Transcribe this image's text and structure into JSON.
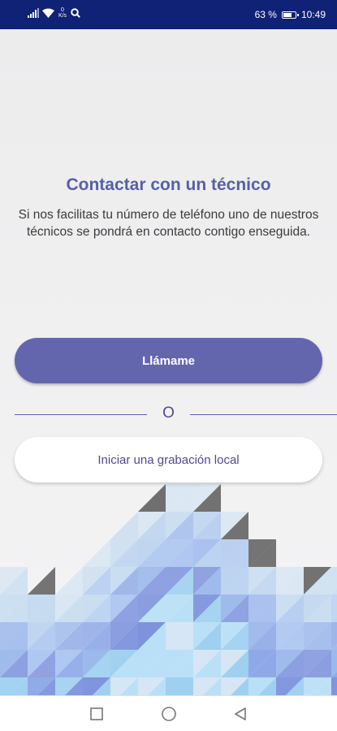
{
  "status_bar": {
    "network_speed": "0",
    "network_unit": "K/s",
    "battery_percent": "63 %",
    "battery_level": 0.63,
    "time": "10:49"
  },
  "main": {
    "title": "Contactar con un técnico",
    "description": "Si nos facilitas tu número de teléfono uno de nuestros técnicos se pondrá en contacto contigo enseguida.",
    "call_button_label": "Llámame",
    "divider_text": "O",
    "record_button_label": "Iniciar una grabación local"
  },
  "colors": {
    "status_bar": "#0f2275",
    "accent": "#6366ad",
    "title": "#5560a8"
  },
  "nav_bar": {
    "icons": [
      "recent-apps-icon",
      "home-icon",
      "back-icon"
    ]
  }
}
